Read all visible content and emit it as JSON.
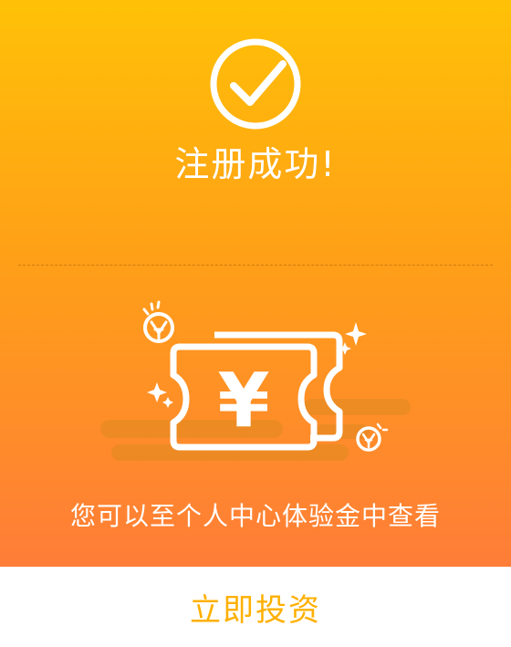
{
  "success": {
    "title": "注册成功!",
    "icon": "check-circle-icon"
  },
  "illustration": {
    "icon": "coupon-yuan-icon",
    "glyph": "¥",
    "coin_icon": "coin-icon",
    "sparkle_icon": "sparkle-icon"
  },
  "message": "您可以至个人中心体验金中查看",
  "action": {
    "invest_label": "立即投资"
  },
  "colors": {
    "gradient_top": "#ffc107",
    "gradient_bottom": "#ff7d38",
    "accent": "#ffb000",
    "white": "#ffffff"
  }
}
